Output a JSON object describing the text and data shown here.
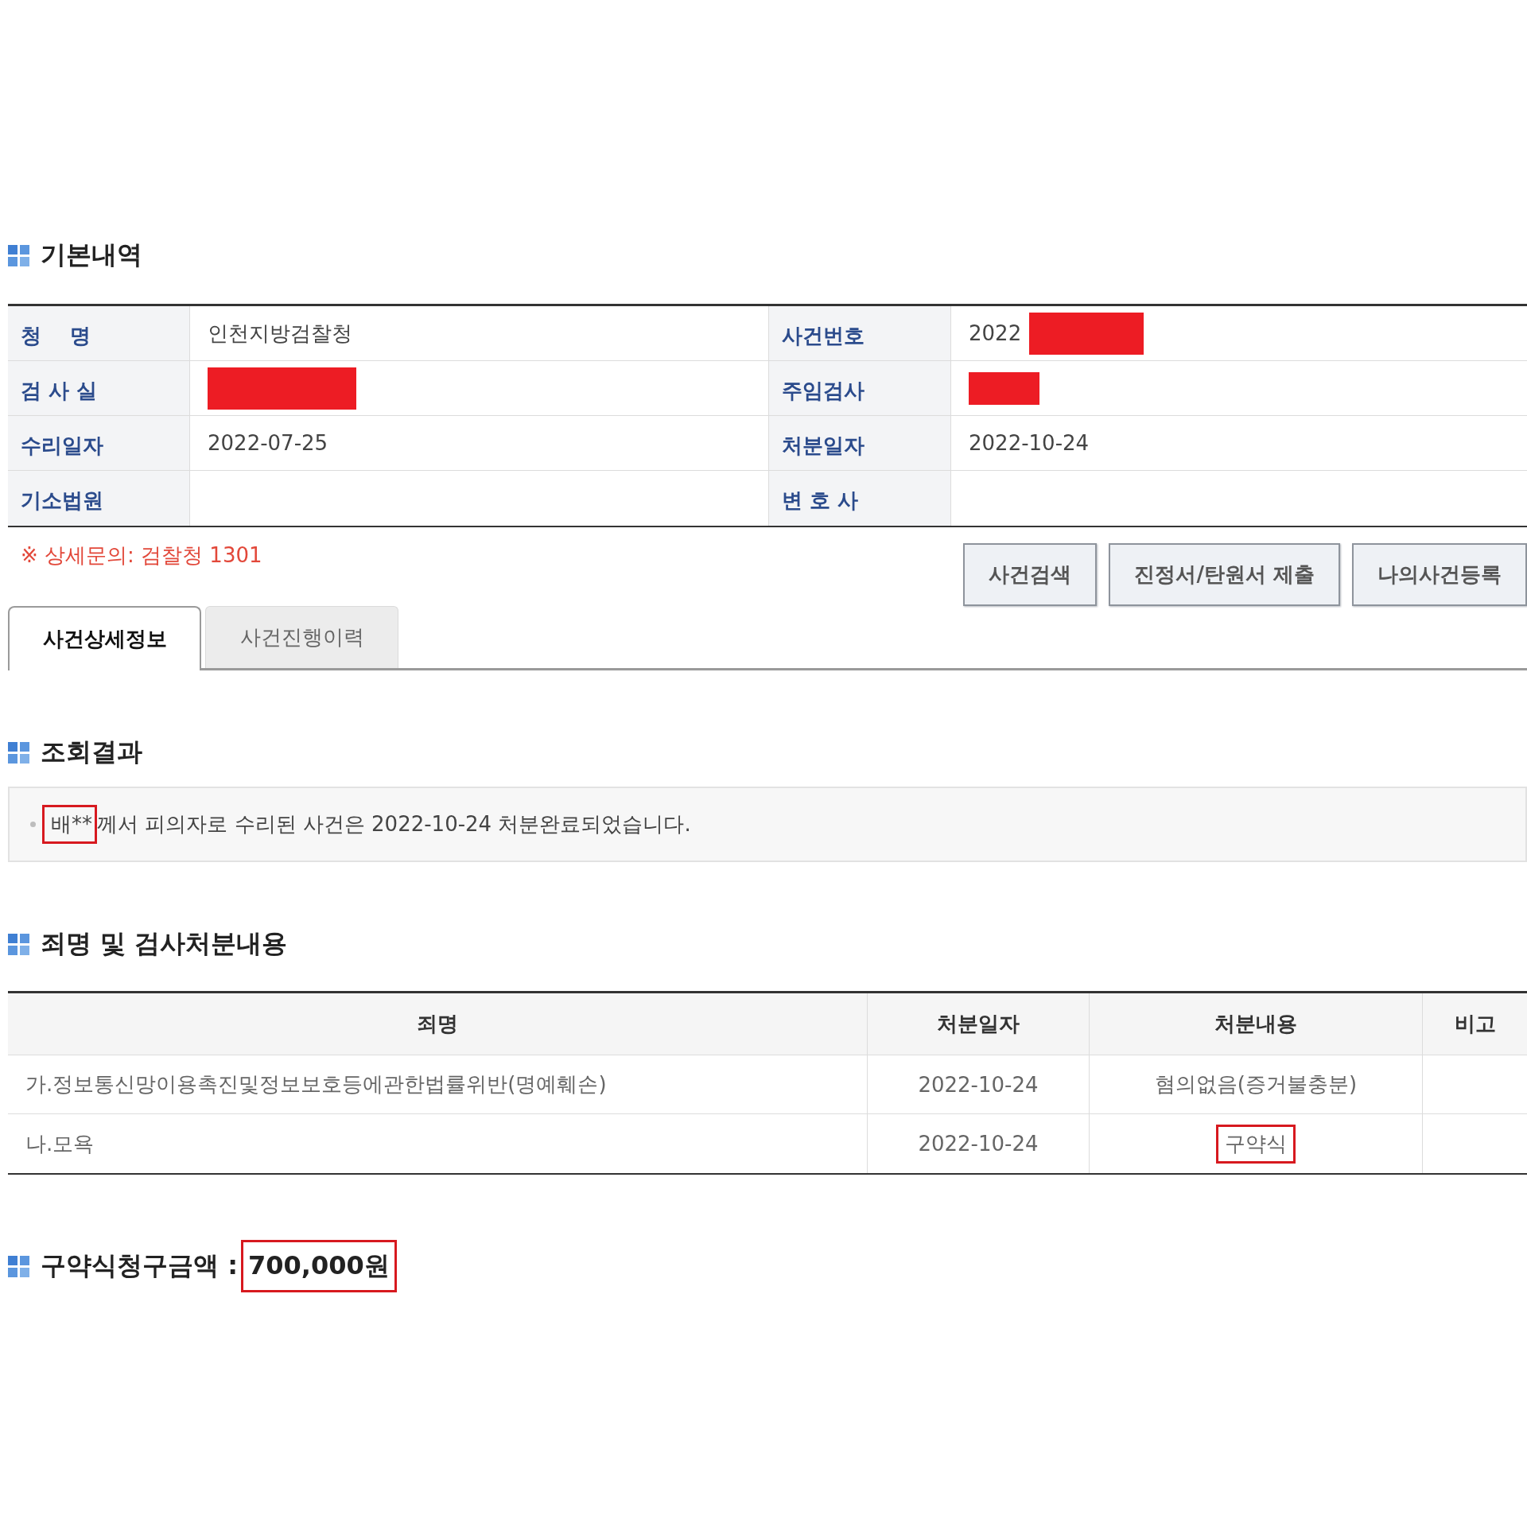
{
  "basic_info": {
    "title": "기본내역",
    "fields": [
      {
        "label": "청    명",
        "value": "인천지방검찰청",
        "redacted": false
      },
      {
        "label": "사건번호",
        "value": "2022",
        "redacted": true
      },
      {
        "label": "검 사 실",
        "redacted": true
      },
      {
        "label": "주임검사",
        "redacted": true
      },
      {
        "label": "수리일자",
        "value": "2022-07-25",
        "redacted": false
      },
      {
        "label": "처분일자",
        "value": "2022-10-24",
        "redacted": false
      },
      {
        "label": "기소법원",
        "redacted": false
      },
      {
        "label": "변 호 사",
        "redacted": false
      }
    ]
  },
  "inquiry_note": "※ 상세문의: 검찰청 1301",
  "buttons": [
    "사건검색",
    "진정서/탄원서 제출",
    "나의사건등록"
  ],
  "tabs": [
    {
      "label": "사건상세정보",
      "selected": true
    },
    {
      "label": "사건진행이력",
      "selected": false
    }
  ],
  "result": {
    "title": "조회결과",
    "message": [
      {
        "text": "배**",
        "highlighted": true
      },
      {
        "text": "께서 피의자로 수리된 사건은 2022-10-24 처분완료되었습니다.",
        "highlighted": false
      }
    ]
  },
  "charges": {
    "title": "죄명 및 검사처분내용",
    "columns": [
      "죄명",
      "처분일자",
      "처분내용",
      "비고"
    ],
    "rows": [
      {
        "charge": "가.정보통신망이용촉진및정보보호등에관한법률위반(명예훼손)",
        "date": "2022-10-24",
        "disposition": "혐의없음(증거불충분)",
        "highlighted": false
      },
      {
        "charge": "나.모욕",
        "date": "2022-10-24",
        "disposition": "구약식",
        "highlighted": true
      }
    ]
  },
  "amount": {
    "label": "구약식청구금액 :",
    "value": "700,000원",
    "highlighted": true
  }
}
